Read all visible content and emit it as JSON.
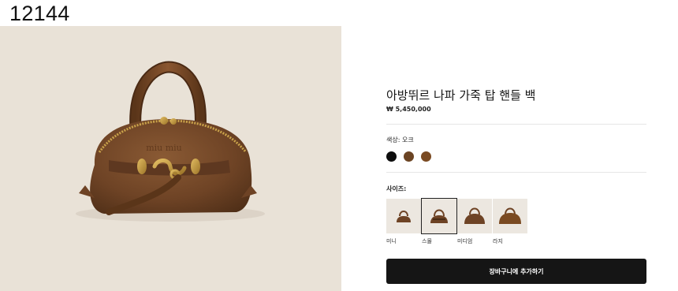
{
  "page_id": "12144",
  "product": {
    "title": "아방뛰르 나파 가죽 탑 핸들 백",
    "price": "₩ 5,450,000"
  },
  "color": {
    "label": "색상: 오크",
    "swatches": [
      {
        "name": "black",
        "hex": "#0d0d0d"
      },
      {
        "name": "oak",
        "hex": "#6b4423"
      },
      {
        "name": "cognac",
        "hex": "#7a4a22"
      }
    ]
  },
  "size": {
    "label": "사이즈:",
    "options": [
      {
        "name": "미니",
        "selected": false
      },
      {
        "name": "스몰",
        "selected": true
      },
      {
        "name": "미디엄",
        "selected": false
      },
      {
        "name": "라지",
        "selected": false
      }
    ]
  },
  "cart": {
    "button_label": "장바구니에 추가하기"
  },
  "image": {
    "logo_text": "miu miu"
  }
}
